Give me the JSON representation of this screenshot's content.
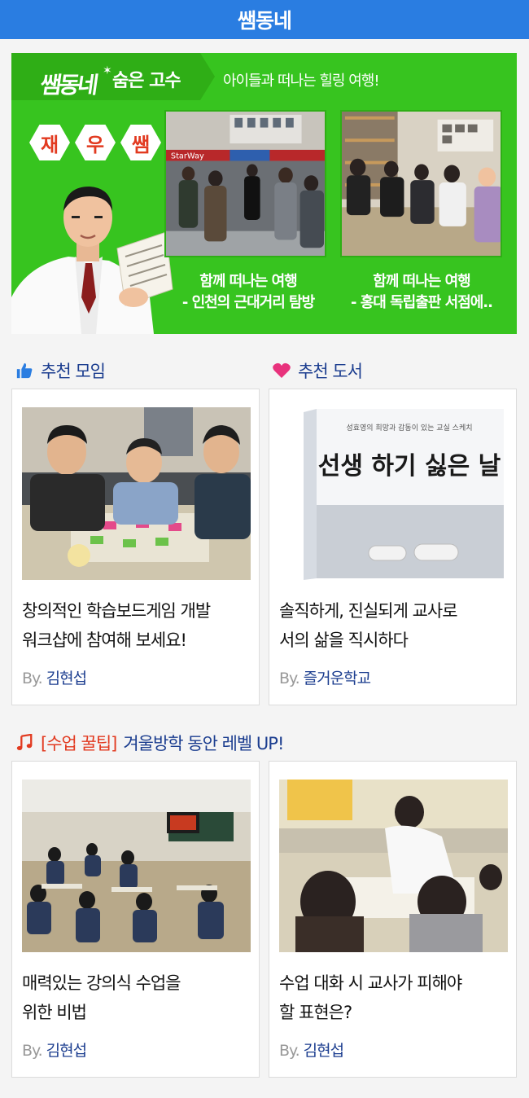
{
  "header": {
    "title": "쌤동네"
  },
  "banner": {
    "logo_text": "쌤동네",
    "kicker": "숨은 고수",
    "tagline": "아이들과 떠나는 힐링 여행!",
    "hex_chars": [
      "재",
      "우",
      "쌤"
    ],
    "photos": [
      {
        "caption_line1": "함께 떠나는 여행",
        "caption_line2": "- 인천의 근대거리 탐방",
        "sign_text": "StarWay"
      },
      {
        "caption_line1": "함께 떠나는 여행",
        "caption_line2": "- 홍대 독립출판 서점에.."
      }
    ]
  },
  "recommend": {
    "meetup": {
      "label": "추천 모임",
      "card": {
        "title_line1": "창의적인 학습보드게임 개발",
        "title_line2": "워크샵에 참여해 보세요!",
        "by_prefix": "By.",
        "author": "김현섭"
      }
    },
    "book": {
      "label": "추천 도서",
      "card": {
        "title_line1": "솔직하게, 진실되게 교사로",
        "title_line2": "서의 삶을 직시하다",
        "by_prefix": "By.",
        "author": "즐거운학교",
        "cover_title": "선생 하기 싫은 날",
        "cover_subtitle": "성효영의 희망과 감동이 있는 교실 스케치"
      }
    }
  },
  "tips": {
    "bracket_label": "[수업 꿀팁]",
    "headline": "겨울방학 동안 레벨 UP!",
    "cards": [
      {
        "title_line1": "매력있는 강의식 수업을",
        "title_line2": "위한 비법",
        "by_prefix": "By.",
        "author": "김현섭"
      },
      {
        "title_line1": "수업 대화 시 교사가 피해야",
        "title_line2": "할 표현은?",
        "by_prefix": "By.",
        "author": "김현섭"
      }
    ]
  },
  "colors": {
    "header_blue": "#2a7de1",
    "banner_green": "#37c41f",
    "accent_red": "#e23a20",
    "heading_navy": "#1b3d8f",
    "heart_pink": "#e8327c"
  },
  "icons": [
    "thumbs-up-icon",
    "heart-icon",
    "music-note-icon",
    "sparkle-icon"
  ]
}
